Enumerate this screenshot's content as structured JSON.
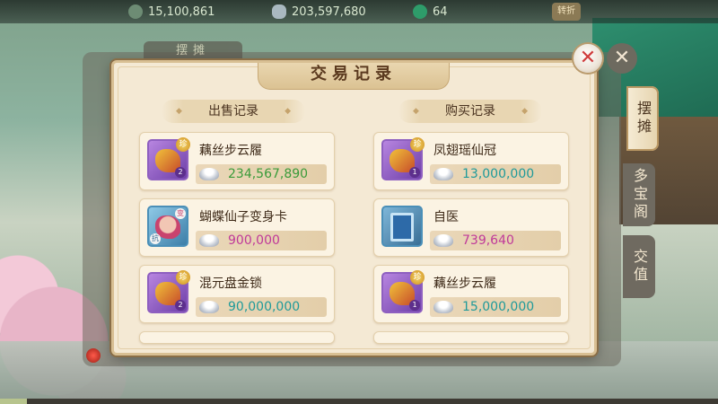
{
  "topbar": {
    "resources": [
      {
        "icon": "coin-icon",
        "amount": "15,100,861"
      },
      {
        "icon": "silver-ingot-icon",
        "amount": "203,597,680"
      },
      {
        "icon": "jade-icon",
        "amount": "64"
      }
    ],
    "button_label": "转折"
  },
  "background": {
    "tab_label": "摆摊"
  },
  "side_tabs": [
    "摆摊",
    "多宝阁",
    "交值"
  ],
  "dialog": {
    "title": "交易记录",
    "sell_header": "出售记录",
    "buy_header": "购买记录",
    "sell_records": [
      {
        "name": "藕丝步云履",
        "price": "234,567,890",
        "price_color": "green",
        "icon": "boots-icon",
        "badge": "珍",
        "level": "2"
      },
      {
        "name": "蝴蝶仙子变身卡",
        "price": "900,000",
        "price_color": "magenta",
        "icon": "transform-card-icon",
        "badge": "变",
        "level": "抗"
      },
      {
        "name": "混元盘金锁",
        "price": "90,000,000",
        "price_color": "teal",
        "icon": "golden-lock-icon",
        "badge": "珍",
        "level": "2"
      }
    ],
    "buy_records": [
      {
        "name": "凤翅瑶仙冠",
        "price": "13,000,000",
        "price_color": "teal",
        "icon": "crown-icon",
        "badge": "珍",
        "level": "1"
      },
      {
        "name": "自医",
        "price": "739,640",
        "price_color": "magenta",
        "icon": "skill-book-icon",
        "badge": "",
        "level": ""
      },
      {
        "name": "藕丝步云履",
        "price": "15,000,000",
        "price_color": "teal",
        "icon": "boots-icon",
        "badge": "珍",
        "level": "1"
      }
    ]
  },
  "colors": {
    "dialog_bg": "#f4e9d4",
    "border": "#d8bf93",
    "price_green": "#3a9b3a",
    "price_magenta": "#c0399a",
    "price_teal": "#1f9a9a",
    "close_x": "#cf3b3b"
  }
}
